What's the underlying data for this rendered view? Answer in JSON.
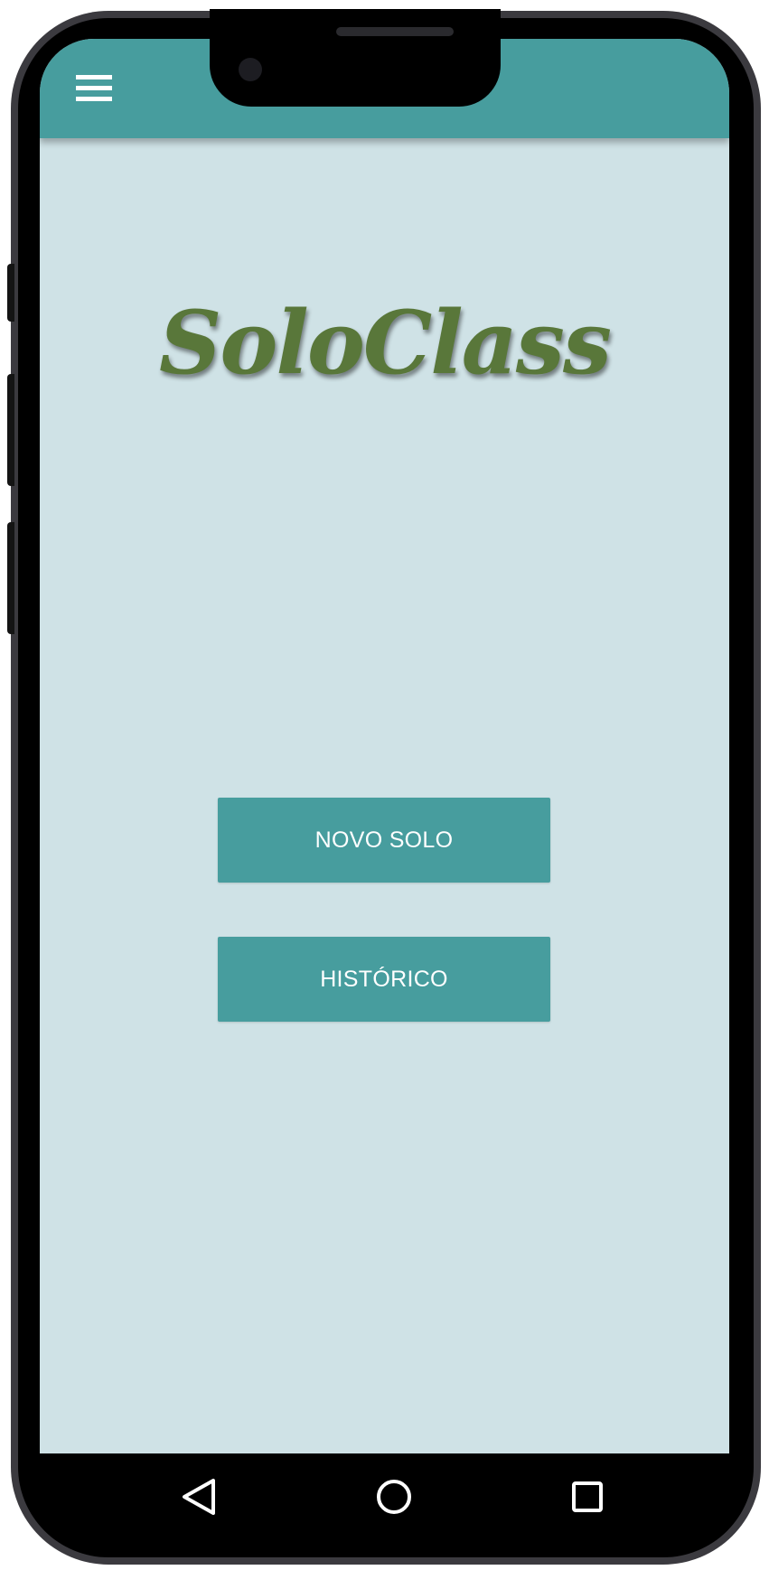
{
  "app": {
    "logo_text": "SoloClass",
    "colors": {
      "primary": "#479d9e",
      "background": "#cfe2e6",
      "logo": "#59773a"
    }
  },
  "appbar": {
    "menu_icon": "hamburger-menu-icon"
  },
  "main": {
    "buttons": {
      "novo_solo": "NOVO SOLO",
      "historico": "HISTÓRICO"
    }
  },
  "navbar": {
    "icons": [
      "back-triangle-icon",
      "home-circle-icon",
      "recent-apps-square-icon"
    ]
  }
}
